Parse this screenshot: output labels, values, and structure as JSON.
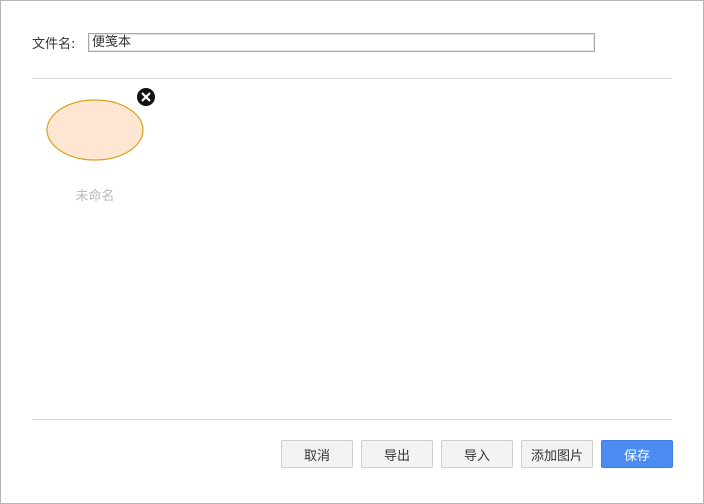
{
  "form": {
    "filename_label": "文件名:",
    "filename_value": "便笺本"
  },
  "shapes": [
    {
      "name": "未命名",
      "fill": "#ffe6d2",
      "stroke": "#d9a21b"
    }
  ],
  "buttons": {
    "cancel": "取消",
    "export": "导出",
    "import": "导入",
    "add_image": "添加图片",
    "save": "保存"
  },
  "colors": {
    "save_button": "#4a8cf0",
    "shape_fill": "#ffe6d2",
    "shape_stroke": "#d9a21b"
  }
}
